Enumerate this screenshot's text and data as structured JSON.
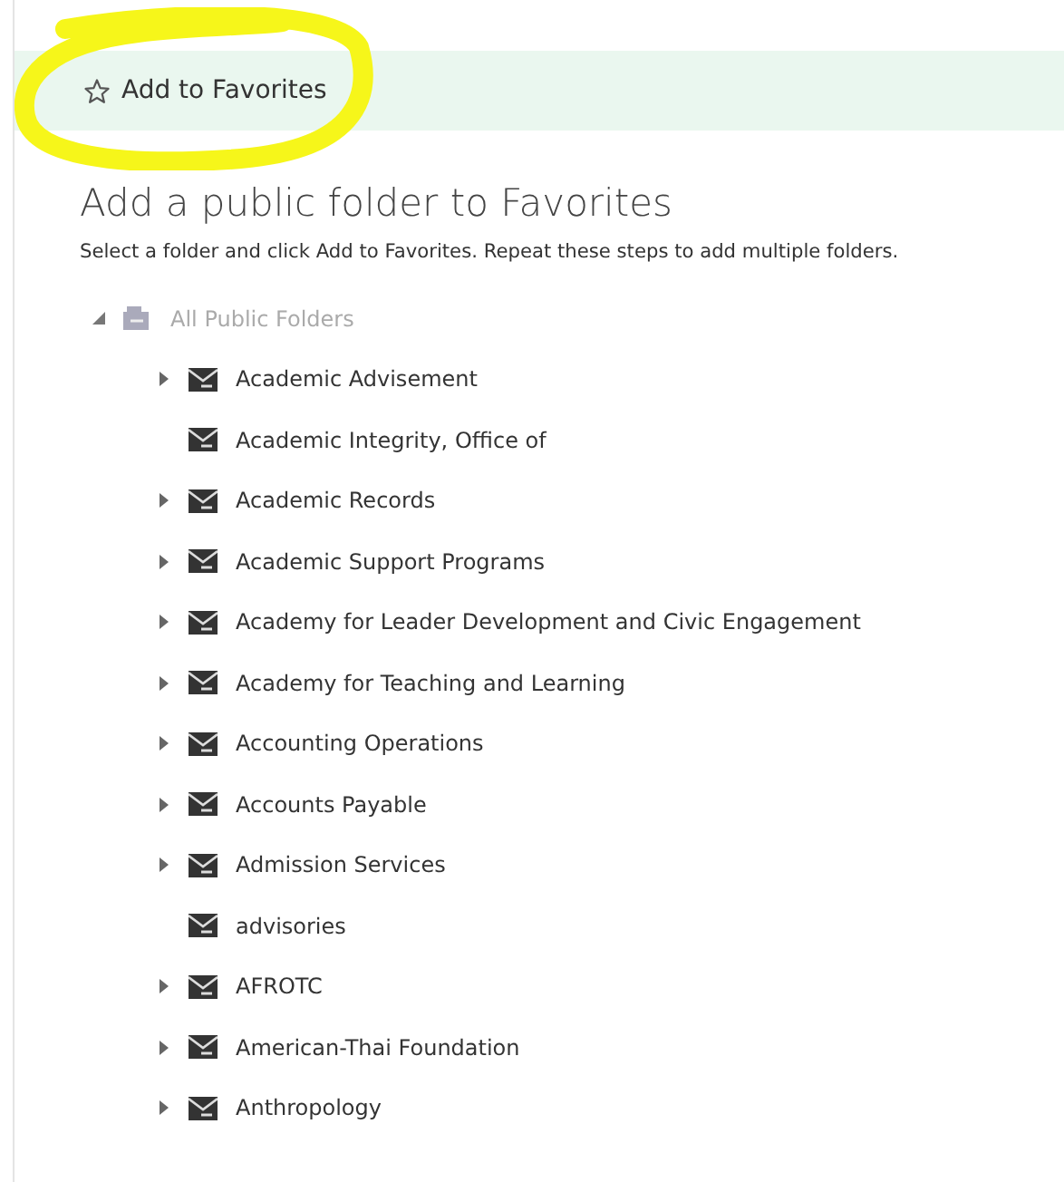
{
  "toolbar": {
    "button": "Add to Favorites"
  },
  "heading": "Add a public folder to Favorites",
  "instructions": "Select a folder and click Add to Favorites. Repeat these steps to add multiple folders.",
  "tree": {
    "label": "All Public Folders",
    "expanded": true,
    "children": [
      {
        "label": "Academic Advisement",
        "expandable": true
      },
      {
        "label": "Academic Integrity, Office of",
        "expandable": false
      },
      {
        "label": "Academic Records",
        "expandable": true
      },
      {
        "label": "Academic Support Programs",
        "expandable": true
      },
      {
        "label": "Academy for Leader Development and Civic Engagement",
        "expandable": true
      },
      {
        "label": "Academy for Teaching and Learning",
        "expandable": true
      },
      {
        "label": "Accounting Operations",
        "expandable": true
      },
      {
        "label": "Accounts Payable",
        "expandable": true
      },
      {
        "label": "Admission Services",
        "expandable": true
      },
      {
        "label": "advisories",
        "expandable": false
      },
      {
        "label": "AFROTC",
        "expandable": true
      },
      {
        "label": "American-Thai Foundation",
        "expandable": true
      },
      {
        "label": "Anthropology",
        "expandable": true
      }
    ]
  }
}
